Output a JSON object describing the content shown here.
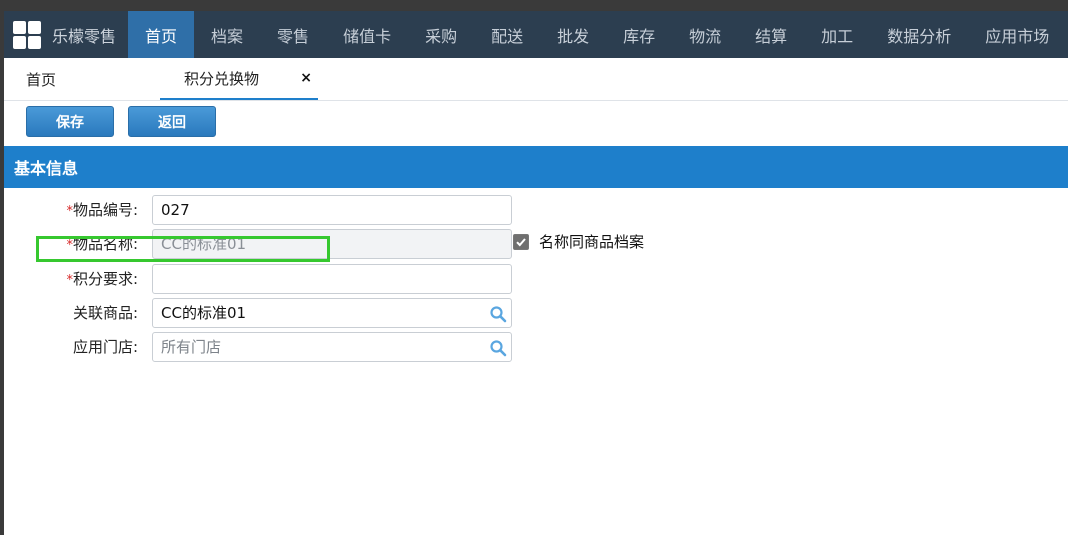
{
  "brand": "乐檬零售",
  "nav": {
    "items": [
      {
        "label": "首页",
        "active": true
      },
      {
        "label": "档案",
        "active": false
      },
      {
        "label": "零售",
        "active": false
      },
      {
        "label": "储值卡",
        "active": false
      },
      {
        "label": "采购",
        "active": false
      },
      {
        "label": "配送",
        "active": false
      },
      {
        "label": "批发",
        "active": false
      },
      {
        "label": "库存",
        "active": false
      },
      {
        "label": "物流",
        "active": false
      },
      {
        "label": "结算",
        "active": false
      },
      {
        "label": "加工",
        "active": false
      },
      {
        "label": "数据分析",
        "active": false
      },
      {
        "label": "应用市场",
        "active": false
      }
    ]
  },
  "tabs": {
    "home": "首页",
    "current": "积分兑换物",
    "close_symbol": "×"
  },
  "toolbar": {
    "save_label": "保存",
    "back_label": "返回"
  },
  "section": {
    "title": "基本信息"
  },
  "form": {
    "required_mark": "*",
    "item_code_label": "物品编号:",
    "item_code_value": "027",
    "item_name_label": "物品名称:",
    "item_name_value": "CC的标准01",
    "points_label": "积分要求:",
    "points_value": "",
    "product_label": "关联商品:",
    "product_value": "CC的标准01",
    "store_label": "应用门店:",
    "store_placeholder": "所有门店",
    "same_name_checkbox_label": "名称同商品档案",
    "same_name_checked": true
  },
  "colors": {
    "nav_bg": "#2c3e50",
    "nav_active": "#2f6fa8",
    "primary": "#1e7fcb",
    "highlight": "#36c82f"
  }
}
